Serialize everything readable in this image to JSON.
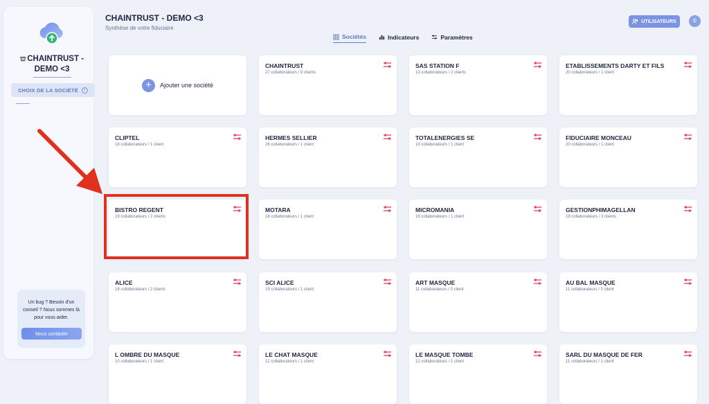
{
  "sidebar": {
    "org_name": "CHAINTRUST - DEMO <3",
    "choose_company": "CHOIX DE LA SOCIÉTÉ",
    "help_text": "Un bug ? Besoin d'un conseil ? Nous sommes là pour vous aider.",
    "help_button": "Nous contacter"
  },
  "header": {
    "title": "CHAINTRUST - DEMO <3",
    "subtitle": "Synthèse de votre fiduciaire",
    "tabs": [
      {
        "label": "Sociétés",
        "icon": "building-icon",
        "active": true
      },
      {
        "label": "Indicateurs",
        "icon": "bar-chart-icon",
        "active": false
      },
      {
        "label": "Paramètres",
        "icon": "sliders-icon",
        "active": false
      }
    ],
    "users_button": "UTILISATEURS",
    "avatar_initial": "C"
  },
  "add_company_label": "Ajouter une société",
  "companies": [
    {
      "name": "CHAINTRUST",
      "stats": "27 collaborateurs / 9 clients"
    },
    {
      "name": "SAS STATION F",
      "stats": "13 collaborateurs / 2 clients"
    },
    {
      "name": "ETABLISSEMENTS DARTY ET FILS",
      "stats": "20 collaborateurs / 1 client"
    },
    {
      "name": "CLIPTEL",
      "stats": "18 collaborateurs / 1 client"
    },
    {
      "name": "HERMES SELLIER",
      "stats": "26 collaborateurs / 1 client"
    },
    {
      "name": "TOTALENERGIES SE",
      "stats": "18 collaborateurs / 1 client"
    },
    {
      "name": "FIDUCIAIRE MONCEAU",
      "stats": "20 collaborateurs / 1 client"
    },
    {
      "name": "BISTRO REGENT",
      "stats": "19 collaborateurs / 2 clients"
    },
    {
      "name": "MOTARA",
      "stats": "18 collaborateurs / 1 client"
    },
    {
      "name": "MICROMANIA",
      "stats": "18 collaborateurs / 1 client"
    },
    {
      "name": "GESTIONPHIMAGELLAN",
      "stats": "19 collaborateurs / 3 clients"
    },
    {
      "name": "ALICE",
      "stats": "18 collaborateurs / 2 clients"
    },
    {
      "name": "SCI ALICE",
      "stats": "19 collaborateurs / 1 client"
    },
    {
      "name": "ART MASQUE",
      "stats": "11 collaborateurs / 0 client"
    },
    {
      "name": "AU BAL MASQUE",
      "stats": "11 collaborateurs / 0 client"
    },
    {
      "name": "L OMBRE DU MASQUE",
      "stats": "10 collaborateurs / 1 client"
    },
    {
      "name": "LE CHAT MASQUE",
      "stats": "12 collaborateurs / 1 client"
    },
    {
      "name": "LE MASQUE TOMBE",
      "stats": "12 collaborateurs / 1 client"
    },
    {
      "name": "SARL DU MASQUE DE FER",
      "stats": "11 collaborateurs / 1 client"
    }
  ],
  "highlighted_company": "BISTRO REGENT",
  "colors": {
    "accent": "#5f78c7",
    "settings_icon": "#e0375a",
    "annotation": "#e0301e",
    "background": "#eef1f8"
  }
}
